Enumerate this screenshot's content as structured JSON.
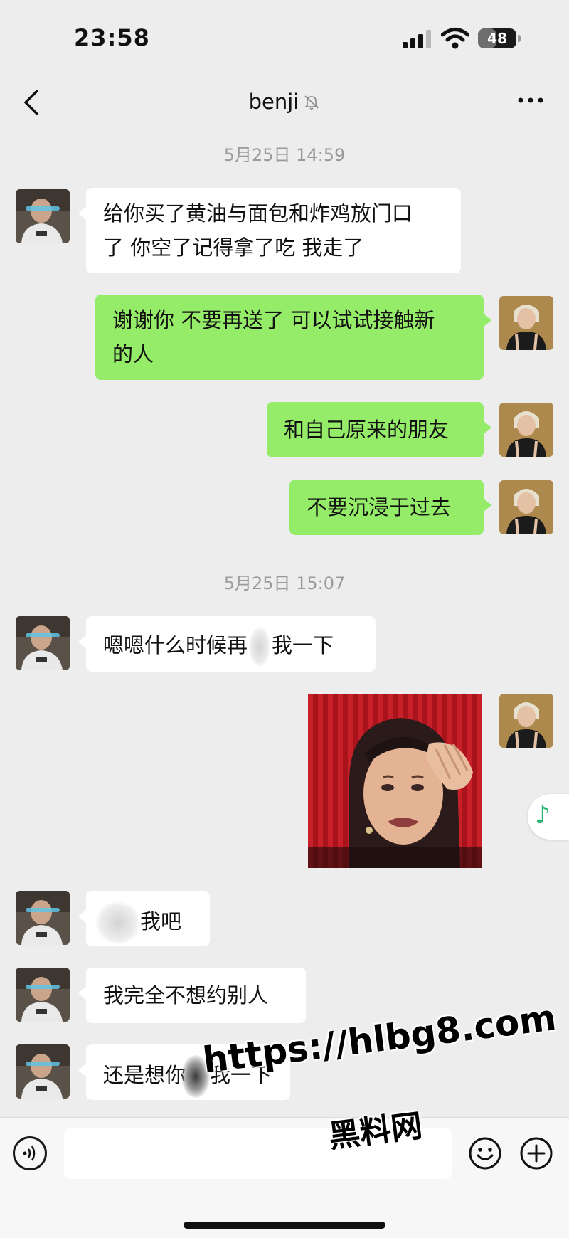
{
  "status_bar": {
    "time": "23:58",
    "battery": "48",
    "battery_level": 0.48
  },
  "header": {
    "title": "benji",
    "icons": [
      "back-icon",
      "mute-icon",
      "more-icon"
    ]
  },
  "timestamps": [
    "5月25日 14:59",
    "5月25日 15:07"
  ],
  "messages": [
    {
      "side": "left",
      "lines": [
        "给你买了黄油与面包和炸鸡放门口",
        "了 你空了记得拿了吃 我走了"
      ]
    },
    {
      "side": "right",
      "lines": [
        "谢谢你 不要再送了 可以试试接触新",
        "的人"
      ]
    },
    {
      "side": "right",
      "lines": [
        "和自己原来的朋友"
      ]
    },
    {
      "side": "right",
      "lines": [
        "不要沉浸于过去"
      ]
    },
    {
      "side": "left",
      "parts": [
        "嗯嗯什么时候再",
        "我一下"
      ]
    },
    {
      "side": "right",
      "type": "sticker",
      "icon": "crying-woman-sticker"
    },
    {
      "side": "left",
      "parts": [
        "",
        "我吧"
      ]
    },
    {
      "side": "left",
      "lines": [
        "我完全不想约别人"
      ]
    },
    {
      "side": "left",
      "parts": [
        "还是想你",
        "我一下"
      ]
    }
  ],
  "input_bar": {
    "placeholder": "",
    "icons": [
      "voice-icon",
      "emoji-icon",
      "plus-icon"
    ]
  },
  "floating": {
    "icon": "music-note-icon",
    "glyph": "♪"
  },
  "watermark": {
    "url": "https://hlbg8.com",
    "brand": "黑料网"
  },
  "colors": {
    "background": "#ededed",
    "sent_bubble": "#95ec69",
    "received_bubble": "#ffffff",
    "timestamp": "#9a9a9a"
  }
}
